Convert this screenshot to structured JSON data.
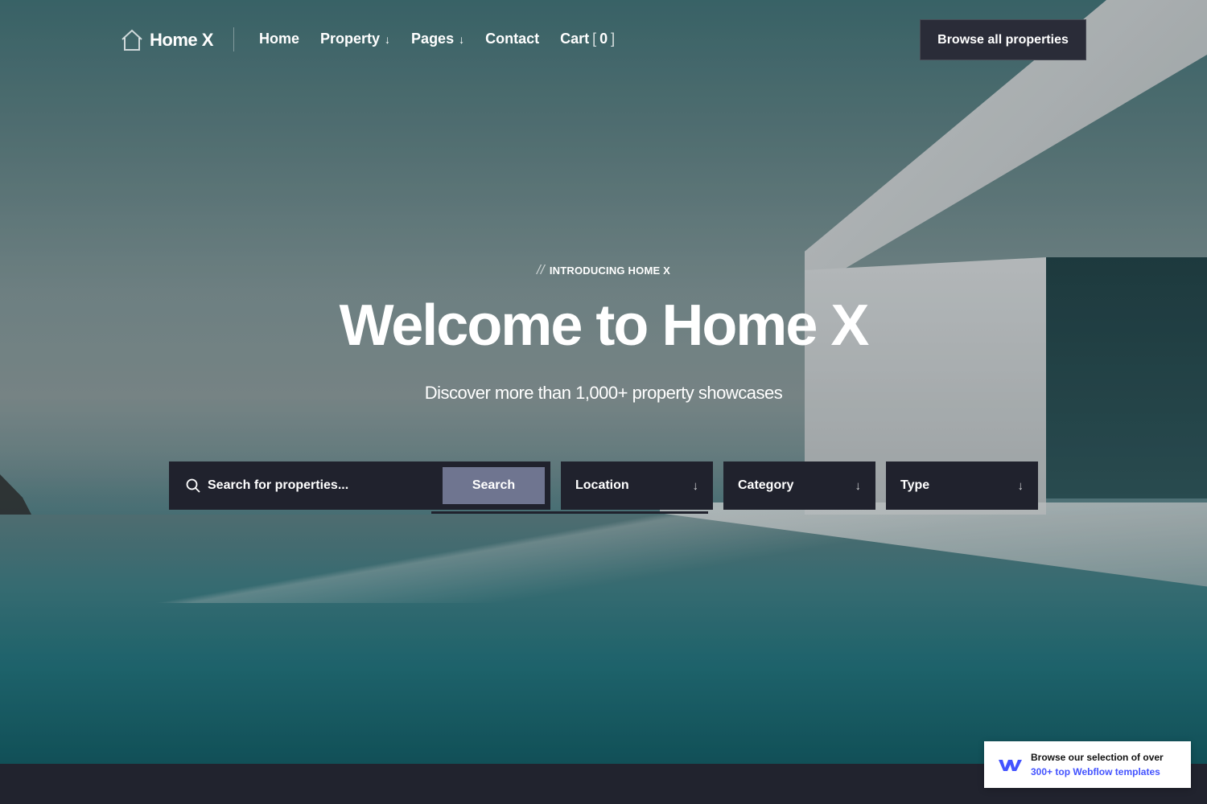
{
  "brand": {
    "name": "Home X",
    "logo_icon": "house-outline-icon"
  },
  "nav": {
    "items": [
      {
        "label": "Home",
        "has_dropdown": false
      },
      {
        "label": "Property",
        "has_dropdown": true
      },
      {
        "label": "Pages",
        "has_dropdown": true
      },
      {
        "label": "Contact",
        "has_dropdown": false
      }
    ],
    "cart": {
      "label": "Cart",
      "count": "0"
    },
    "cta": "Browse all properties"
  },
  "hero": {
    "eyebrow_mark": "//",
    "eyebrow": "INTRODUCING HOME X",
    "title": "Welcome to Home X",
    "subtitle": "Discover more than 1,000+ property showcases"
  },
  "search": {
    "placeholder": "Search for properties...",
    "button": "Search",
    "filters": [
      {
        "label": "Location"
      },
      {
        "label": "Category"
      },
      {
        "label": "Type"
      }
    ]
  },
  "badge": {
    "line1": "Browse our selection of over",
    "line2": "300+ top Webflow templates",
    "icon": "webflow-logo-icon"
  },
  "colors": {
    "dark_panel": "#20222d",
    "search_button": "#6f7590",
    "accent_link": "#4353ff"
  }
}
